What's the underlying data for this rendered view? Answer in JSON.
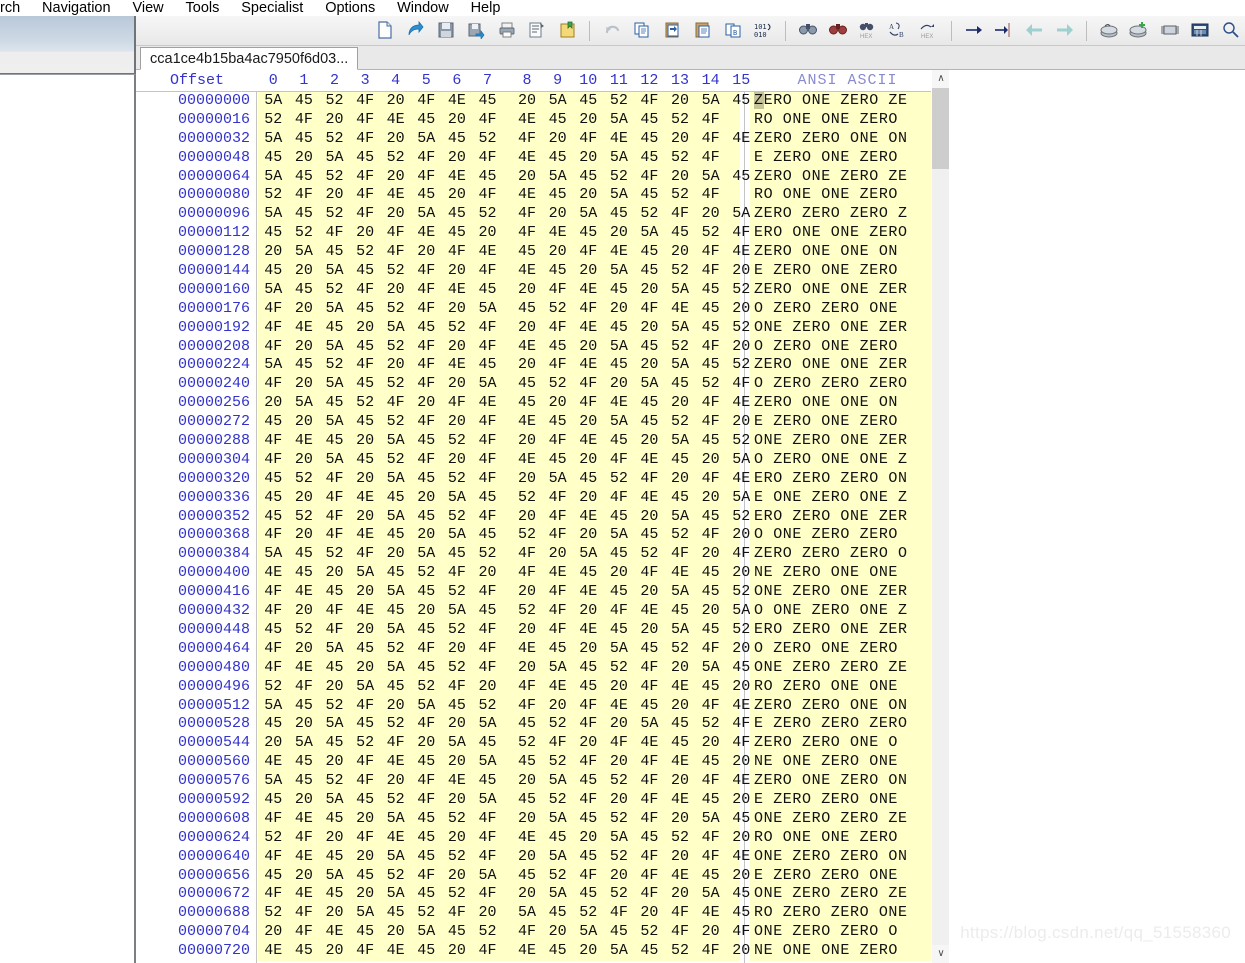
{
  "app": {
    "name": "WinHex",
    "watermark": "https://blog.csdn.net/qq_51558360"
  },
  "menubar": {
    "items": [
      {
        "label": "rch",
        "name": "menu-search-clipped"
      },
      {
        "label": "Navigation",
        "name": "menu-navigation"
      },
      {
        "label": "View",
        "name": "menu-view"
      },
      {
        "label": "Tools",
        "name": "menu-tools"
      },
      {
        "label": "Specialist",
        "name": "menu-specialist"
      },
      {
        "label": "Options",
        "name": "menu-options"
      },
      {
        "label": "Window",
        "name": "menu-window"
      },
      {
        "label": "Help",
        "name": "menu-help"
      }
    ]
  },
  "toolbar": {
    "groups": [
      [
        "new-file-icon",
        "open-file-icon",
        "save-icon",
        "save-as-icon",
        "print-icon",
        "file-properties-icon",
        "open-folder-icon"
      ],
      [
        "undo-icon",
        "copy-icon",
        "paste-into-new-icon",
        "paste-clipboard-icon",
        "copy-block-icon",
        "binary-data-icon"
      ],
      [
        "find-text-icon",
        "find-hex-icon",
        "replace-hex-icon",
        "goto-block-icon",
        "goto-hex-icon"
      ],
      [
        "goto-offset-icon",
        "goto-end-icon",
        "back-arrow-icon",
        "forward-arrow-icon"
      ],
      [
        "open-disk-icon",
        "open-disk-plus-icon",
        "open-ram-icon",
        "calculator-icon",
        "analyze-icon",
        "snapshot-icon",
        "chart-icon",
        "settings-gear-icon"
      ],
      [
        "select-block-icon",
        "report-icon",
        "prev-marker-icon",
        "next-marker-icon"
      ],
      [
        "help-book-icon"
      ]
    ]
  },
  "document": {
    "tab_label": "cca1ce4b15ba4ac7950f6d03..."
  },
  "hexview": {
    "offset_header": "Offset",
    "column_headers": [
      "0",
      "1",
      "2",
      "3",
      "4",
      "5",
      "6",
      "7",
      "8",
      "9",
      "10",
      "11",
      "12",
      "13",
      "14",
      "15"
    ],
    "ascii_header": "ANSI ASCII",
    "cursor_char": "Z",
    "rows": [
      {
        "offset": "00000000",
        "bytes": [
          "5A",
          "45",
          "52",
          "4F",
          "20",
          "4F",
          "4E",
          "45",
          "20",
          "5A",
          "45",
          "52",
          "4F",
          "20",
          "5A",
          "45"
        ],
        "ascii": "ZERO ONE ZERO ZE"
      },
      {
        "offset": "00000016",
        "bytes": [
          "52",
          "4F",
          "20",
          "4F",
          "4E",
          "45",
          "20",
          "4F",
          "4E",
          "45",
          "20",
          "5A",
          "45",
          "52",
          "4F",
          ""
        ],
        "ascii": "RO ONE ONE ZERO"
      },
      {
        "offset": "00000032",
        "bytes": [
          "5A",
          "45",
          "52",
          "4F",
          "20",
          "5A",
          "45",
          "52",
          "4F",
          "20",
          "4F",
          "4E",
          "45",
          "20",
          "4F",
          "4E"
        ],
        "ascii": "ZERO ZERO ONE ON"
      },
      {
        "offset": "00000048",
        "bytes": [
          "45",
          "20",
          "5A",
          "45",
          "52",
          "4F",
          "20",
          "4F",
          "4E",
          "45",
          "20",
          "5A",
          "45",
          "52",
          "4F",
          ""
        ],
        "ascii": "E ZERO ONE ZERO"
      },
      {
        "offset": "00000064",
        "bytes": [
          "5A",
          "45",
          "52",
          "4F",
          "20",
          "4F",
          "4E",
          "45",
          "20",
          "5A",
          "45",
          "52",
          "4F",
          "20",
          "5A",
          "45"
        ],
        "ascii": "ZERO ONE ZERO ZE"
      },
      {
        "offset": "00000080",
        "bytes": [
          "52",
          "4F",
          "20",
          "4F",
          "4E",
          "45",
          "20",
          "4F",
          "4E",
          "45",
          "20",
          "5A",
          "45",
          "52",
          "4F",
          ""
        ],
        "ascii": "RO ONE ONE ZERO"
      },
      {
        "offset": "00000096",
        "bytes": [
          "5A",
          "45",
          "52",
          "4F",
          "20",
          "5A",
          "45",
          "52",
          "4F",
          "20",
          "5A",
          "45",
          "52",
          "4F",
          "20",
          "5A"
        ],
        "ascii": "ZERO ZERO ZERO Z"
      },
      {
        "offset": "00000112",
        "bytes": [
          "45",
          "52",
          "4F",
          "20",
          "4F",
          "4E",
          "45",
          "20",
          "4F",
          "4E",
          "45",
          "20",
          "5A",
          "45",
          "52",
          "4F"
        ],
        "ascii": "ERO ONE ONE ZERO"
      },
      {
        "offset": "00000128",
        "bytes": [
          "20",
          "5A",
          "45",
          "52",
          "4F",
          "20",
          "4F",
          "4E",
          "45",
          "20",
          "4F",
          "4E",
          "45",
          "20",
          "4F",
          "4E"
        ],
        "ascii": " ZERO ONE ONE ON"
      },
      {
        "offset": "00000144",
        "bytes": [
          "45",
          "20",
          "5A",
          "45",
          "52",
          "4F",
          "20",
          "4F",
          "4E",
          "45",
          "20",
          "5A",
          "45",
          "52",
          "4F",
          "20"
        ],
        "ascii": "E ZERO ONE ZERO"
      },
      {
        "offset": "00000160",
        "bytes": [
          "5A",
          "45",
          "52",
          "4F",
          "20",
          "4F",
          "4E",
          "45",
          "20",
          "4F",
          "4E",
          "45",
          "20",
          "5A",
          "45",
          "52"
        ],
        "ascii": "ZERO ONE ONE ZER"
      },
      {
        "offset": "00000176",
        "bytes": [
          "4F",
          "20",
          "5A",
          "45",
          "52",
          "4F",
          "20",
          "5A",
          "45",
          "52",
          "4F",
          "20",
          "4F",
          "4E",
          "45",
          "20"
        ],
        "ascii": "O ZERO ZERO ONE"
      },
      {
        "offset": "00000192",
        "bytes": [
          "4F",
          "4E",
          "45",
          "20",
          "5A",
          "45",
          "52",
          "4F",
          "20",
          "4F",
          "4E",
          "45",
          "20",
          "5A",
          "45",
          "52"
        ],
        "ascii": "ONE ZERO ONE ZER"
      },
      {
        "offset": "00000208",
        "bytes": [
          "4F",
          "20",
          "5A",
          "45",
          "52",
          "4F",
          "20",
          "4F",
          "4E",
          "45",
          "20",
          "5A",
          "45",
          "52",
          "4F",
          "20"
        ],
        "ascii": "O ZERO ONE ZERO"
      },
      {
        "offset": "00000224",
        "bytes": [
          "5A",
          "45",
          "52",
          "4F",
          "20",
          "4F",
          "4E",
          "45",
          "20",
          "4F",
          "4E",
          "45",
          "20",
          "5A",
          "45",
          "52"
        ],
        "ascii": "ZERO ONE ONE ZER"
      },
      {
        "offset": "00000240",
        "bytes": [
          "4F",
          "20",
          "5A",
          "45",
          "52",
          "4F",
          "20",
          "5A",
          "45",
          "52",
          "4F",
          "20",
          "5A",
          "45",
          "52",
          "4F"
        ],
        "ascii": "O ZERO ZERO ZERO"
      },
      {
        "offset": "00000256",
        "bytes": [
          "20",
          "5A",
          "45",
          "52",
          "4F",
          "20",
          "4F",
          "4E",
          "45",
          "20",
          "4F",
          "4E",
          "45",
          "20",
          "4F",
          "4E"
        ],
        "ascii": " ZERO ONE ONE ON"
      },
      {
        "offset": "00000272",
        "bytes": [
          "45",
          "20",
          "5A",
          "45",
          "52",
          "4F",
          "20",
          "4F",
          "4E",
          "45",
          "20",
          "5A",
          "45",
          "52",
          "4F",
          "20"
        ],
        "ascii": "E ZERO ONE ZERO"
      },
      {
        "offset": "00000288",
        "bytes": [
          "4F",
          "4E",
          "45",
          "20",
          "5A",
          "45",
          "52",
          "4F",
          "20",
          "4F",
          "4E",
          "45",
          "20",
          "5A",
          "45",
          "52"
        ],
        "ascii": "ONE ZERO ONE ZER"
      },
      {
        "offset": "00000304",
        "bytes": [
          "4F",
          "20",
          "5A",
          "45",
          "52",
          "4F",
          "20",
          "4F",
          "4E",
          "45",
          "20",
          "4F",
          "4E",
          "45",
          "20",
          "5A"
        ],
        "ascii": "O ZERO ONE ONE Z"
      },
      {
        "offset": "00000320",
        "bytes": [
          "45",
          "52",
          "4F",
          "20",
          "5A",
          "45",
          "52",
          "4F",
          "20",
          "5A",
          "45",
          "52",
          "4F",
          "20",
          "4F",
          "4E"
        ],
        "ascii": "ERO ZERO ZERO ON"
      },
      {
        "offset": "00000336",
        "bytes": [
          "45",
          "20",
          "4F",
          "4E",
          "45",
          "20",
          "5A",
          "45",
          "52",
          "4F",
          "20",
          "4F",
          "4E",
          "45",
          "20",
          "5A"
        ],
        "ascii": "E ONE ZERO ONE Z"
      },
      {
        "offset": "00000352",
        "bytes": [
          "45",
          "52",
          "4F",
          "20",
          "5A",
          "45",
          "52",
          "4F",
          "20",
          "4F",
          "4E",
          "45",
          "20",
          "5A",
          "45",
          "52"
        ],
        "ascii": "ERO ZERO ONE ZER"
      },
      {
        "offset": "00000368",
        "bytes": [
          "4F",
          "20",
          "4F",
          "4E",
          "45",
          "20",
          "5A",
          "45",
          "52",
          "4F",
          "20",
          "5A",
          "45",
          "52",
          "4F",
          "20"
        ],
        "ascii": "O ONE ZERO ZERO"
      },
      {
        "offset": "00000384",
        "bytes": [
          "5A",
          "45",
          "52",
          "4F",
          "20",
          "5A",
          "45",
          "52",
          "4F",
          "20",
          "5A",
          "45",
          "52",
          "4F",
          "20",
          "4F"
        ],
        "ascii": "ZERO ZERO ZERO O"
      },
      {
        "offset": "00000400",
        "bytes": [
          "4E",
          "45",
          "20",
          "5A",
          "45",
          "52",
          "4F",
          "20",
          "4F",
          "4E",
          "45",
          "20",
          "4F",
          "4E",
          "45",
          "20"
        ],
        "ascii": "NE ZERO ONE ONE"
      },
      {
        "offset": "00000416",
        "bytes": [
          "4F",
          "4E",
          "45",
          "20",
          "5A",
          "45",
          "52",
          "4F",
          "20",
          "4F",
          "4E",
          "45",
          "20",
          "5A",
          "45",
          "52"
        ],
        "ascii": "ONE ZERO ONE ZER"
      },
      {
        "offset": "00000432",
        "bytes": [
          "4F",
          "20",
          "4F",
          "4E",
          "45",
          "20",
          "5A",
          "45",
          "52",
          "4F",
          "20",
          "4F",
          "4E",
          "45",
          "20",
          "5A"
        ],
        "ascii": "O ONE ZERO ONE Z"
      },
      {
        "offset": "00000448",
        "bytes": [
          "45",
          "52",
          "4F",
          "20",
          "5A",
          "45",
          "52",
          "4F",
          "20",
          "4F",
          "4E",
          "45",
          "20",
          "5A",
          "45",
          "52"
        ],
        "ascii": "ERO ZERO ONE ZER"
      },
      {
        "offset": "00000464",
        "bytes": [
          "4F",
          "20",
          "5A",
          "45",
          "52",
          "4F",
          "20",
          "4F",
          "4E",
          "45",
          "20",
          "5A",
          "45",
          "52",
          "4F",
          "20"
        ],
        "ascii": "O ZERO ONE ZERO"
      },
      {
        "offset": "00000480",
        "bytes": [
          "4F",
          "4E",
          "45",
          "20",
          "5A",
          "45",
          "52",
          "4F",
          "20",
          "5A",
          "45",
          "52",
          "4F",
          "20",
          "5A",
          "45"
        ],
        "ascii": "ONE ZERO ZERO ZE"
      },
      {
        "offset": "00000496",
        "bytes": [
          "52",
          "4F",
          "20",
          "5A",
          "45",
          "52",
          "4F",
          "20",
          "4F",
          "4E",
          "45",
          "20",
          "4F",
          "4E",
          "45",
          "20"
        ],
        "ascii": "RO ZERO ONE ONE"
      },
      {
        "offset": "00000512",
        "bytes": [
          "5A",
          "45",
          "52",
          "4F",
          "20",
          "5A",
          "45",
          "52",
          "4F",
          "20",
          "4F",
          "4E",
          "45",
          "20",
          "4F",
          "4E"
        ],
        "ascii": "ZERO ZERO ONE ON"
      },
      {
        "offset": "00000528",
        "bytes": [
          "45",
          "20",
          "5A",
          "45",
          "52",
          "4F",
          "20",
          "5A",
          "45",
          "52",
          "4F",
          "20",
          "5A",
          "45",
          "52",
          "4F"
        ],
        "ascii": "E ZERO ZERO ZERO"
      },
      {
        "offset": "00000544",
        "bytes": [
          "20",
          "5A",
          "45",
          "52",
          "4F",
          "20",
          "5A",
          "45",
          "52",
          "4F",
          "20",
          "4F",
          "4E",
          "45",
          "20",
          "4F"
        ],
        "ascii": " ZERO ZERO ONE O"
      },
      {
        "offset": "00000560",
        "bytes": [
          "4E",
          "45",
          "20",
          "4F",
          "4E",
          "45",
          "20",
          "5A",
          "45",
          "52",
          "4F",
          "20",
          "4F",
          "4E",
          "45",
          "20"
        ],
        "ascii": "NE ONE ZERO ONE"
      },
      {
        "offset": "00000576",
        "bytes": [
          "5A",
          "45",
          "52",
          "4F",
          "20",
          "4F",
          "4E",
          "45",
          "20",
          "5A",
          "45",
          "52",
          "4F",
          "20",
          "4F",
          "4E"
        ],
        "ascii": "ZERO ONE ZERO ON"
      },
      {
        "offset": "00000592",
        "bytes": [
          "45",
          "20",
          "5A",
          "45",
          "52",
          "4F",
          "20",
          "5A",
          "45",
          "52",
          "4F",
          "20",
          "4F",
          "4E",
          "45",
          "20"
        ],
        "ascii": "E ZERO ZERO ONE"
      },
      {
        "offset": "00000608",
        "bytes": [
          "4F",
          "4E",
          "45",
          "20",
          "5A",
          "45",
          "52",
          "4F",
          "20",
          "5A",
          "45",
          "52",
          "4F",
          "20",
          "5A",
          "45"
        ],
        "ascii": "ONE ZERO ZERO ZE"
      },
      {
        "offset": "00000624",
        "bytes": [
          "52",
          "4F",
          "20",
          "4F",
          "4E",
          "45",
          "20",
          "4F",
          "4E",
          "45",
          "20",
          "5A",
          "45",
          "52",
          "4F",
          "20"
        ],
        "ascii": "RO ONE ONE ZERO"
      },
      {
        "offset": "00000640",
        "bytes": [
          "4F",
          "4E",
          "45",
          "20",
          "5A",
          "45",
          "52",
          "4F",
          "20",
          "5A",
          "45",
          "52",
          "4F",
          "20",
          "4F",
          "4E"
        ],
        "ascii": "ONE ZERO ZERO ON"
      },
      {
        "offset": "00000656",
        "bytes": [
          "45",
          "20",
          "5A",
          "45",
          "52",
          "4F",
          "20",
          "5A",
          "45",
          "52",
          "4F",
          "20",
          "4F",
          "4E",
          "45",
          "20"
        ],
        "ascii": "E ZERO ZERO ONE"
      },
      {
        "offset": "00000672",
        "bytes": [
          "4F",
          "4E",
          "45",
          "20",
          "5A",
          "45",
          "52",
          "4F",
          "20",
          "5A",
          "45",
          "52",
          "4F",
          "20",
          "5A",
          "45"
        ],
        "ascii": "ONE ZERO ZERO ZE"
      },
      {
        "offset": "00000688",
        "bytes": [
          "52",
          "4F",
          "20",
          "5A",
          "45",
          "52",
          "4F",
          "20",
          "5A",
          "45",
          "52",
          "4F",
          "20",
          "4F",
          "4E",
          "45"
        ],
        "ascii": "RO ZERO ZERO ONE"
      },
      {
        "offset": "00000704",
        "bytes": [
          "20",
          "4F",
          "4E",
          "45",
          "20",
          "5A",
          "45",
          "52",
          "4F",
          "20",
          "5A",
          "45",
          "52",
          "4F",
          "20",
          "4F"
        ],
        "ascii": " ONE ZERO ZERO O"
      },
      {
        "offset": "00000720",
        "bytes": [
          "4E",
          "45",
          "20",
          "4F",
          "4E",
          "45",
          "20",
          "4F",
          "4E",
          "45",
          "20",
          "5A",
          "45",
          "52",
          "4F",
          "20"
        ],
        "ascii": "NE ONE ONE ZERO"
      }
    ]
  },
  "scrollbar": {
    "up_arrow": "∧",
    "down_arrow": "∨"
  },
  "colors": {
    "hex_background": "#FFFFC8",
    "offset_text": "#3333CC",
    "ascii_header": "#8A8AD0",
    "cursor_highlight": "#C8C49A"
  }
}
